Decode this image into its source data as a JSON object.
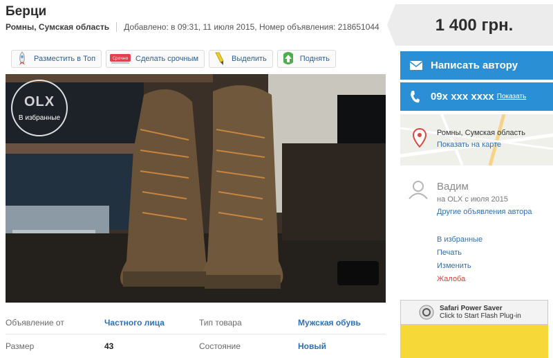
{
  "listing": {
    "title": "Берци",
    "location": "Ромны, Сумская область",
    "added": "Добавлено: в 09:31, 11 июля 2015, Номер объявления: 218651044"
  },
  "toolbar": {
    "top": "Разместить в Топ",
    "urgent": "Сделать срочным",
    "urgent_badge": "Срочно",
    "highlight": "Выделить",
    "raise": "Поднять"
  },
  "photo": {
    "logo": "OLX",
    "favorite": "В избранные"
  },
  "details": [
    {
      "label1": "Объявление от",
      "value1": "Частного лица",
      "label2": "Тип товара",
      "value2": "Мужская обувь"
    },
    {
      "label1": "Размер",
      "value1": "43",
      "label2": "Состояние",
      "value2": "Новый"
    }
  ],
  "sidebar": {
    "price": "1 400 грн.",
    "message": "Написать автору",
    "phone": "09x xxx xxxx",
    "phone_show": "Показать",
    "map_location": "Ромны, Сумская область",
    "map_link": "Показать на карте",
    "user_name": "Вадим",
    "user_since": "на OLX с июля 2015",
    "user_others": "Другие объявления автора",
    "actions": {
      "favorite": "В избранные",
      "print": "Печать",
      "edit": "Изменить",
      "report": "Жалоба"
    },
    "flash_title": "Safari Power Saver",
    "flash_sub": "Click to Start Flash Plug-in"
  },
  "colors": {
    "accent": "#2b8fd6",
    "link": "#2f6fb3",
    "report": "#d9403a",
    "flash_bg": "#f6d838"
  }
}
